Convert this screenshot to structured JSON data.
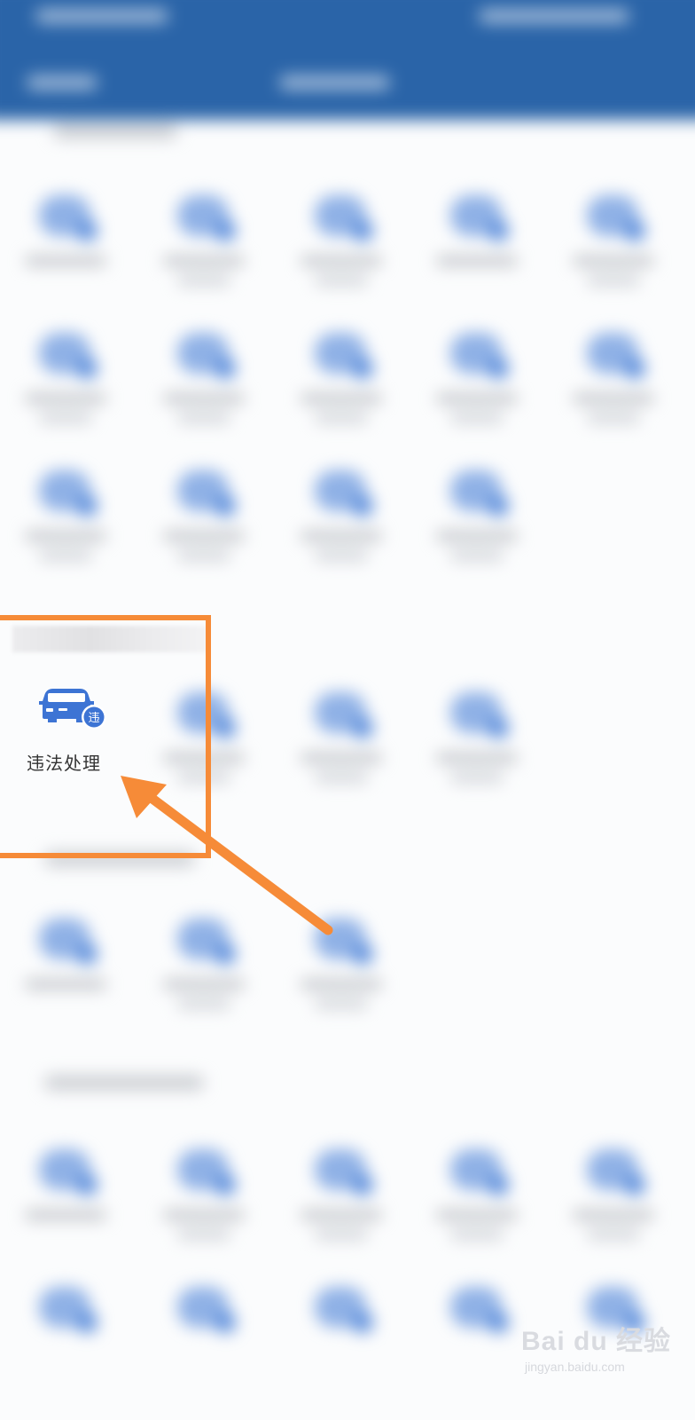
{
  "highlighted_item": {
    "label": "违法处理",
    "badge": "违",
    "icon": "car-violation-icon"
  },
  "watermark": {
    "logo": "Bai du 经验",
    "url": "jingyan.baidu.com"
  },
  "colors": {
    "header": "#2a64a8",
    "accent_icon": "#3d74d4",
    "highlight": "#f68b38",
    "background": "#fbfcfd"
  }
}
